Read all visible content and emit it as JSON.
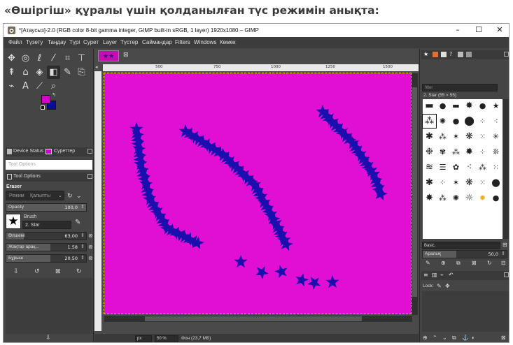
{
  "question": "«Өшіргіш» құралы үшін қолданылған түс режимін анықта:",
  "window": {
    "title": "*[Атаусыз]-2.0 (RGB color 8-bit gamma integer, GIMP built-in sRGB, 1 layer) 1920x1080 – GIMP",
    "minimize": "–",
    "maximize": "☐",
    "close": "✕"
  },
  "menu": [
    "Файл",
    "Түзету",
    "Таңдау",
    "Түрі",
    "Сурет",
    "Layer",
    "Түстер",
    "Саймандар",
    "Filters",
    "Windows",
    "Көмек"
  ],
  "colors": {
    "foreground": "#d400c8",
    "background": "#0a0aa0",
    "image_bg": "#e10ed4",
    "stars": "#1a0fae"
  },
  "left_dock": {
    "tab_device_status": "Device Status",
    "tab_colors": "Суреттер",
    "tool_options_search": "Tool Options",
    "tab_tool_options": "Tool Options",
    "tool_name": "Eraser",
    "mode_label": "Режим",
    "mode_value": "Қалыпты",
    "opacity_label": "Opacity",
    "opacity_value": "100,0",
    "brush_label": "Brush",
    "brush_value": "2. Star",
    "size_label": "Өлшемі",
    "size_value": "63,00",
    "aspect_label": "Жақтар арақ...",
    "aspect_value": "1,58",
    "angle_label": "Бұрыш",
    "angle_value": "20,50"
  },
  "canvas": {
    "ruler_ticks": [
      "500",
      "750",
      "1000",
      "1250",
      "1500"
    ],
    "unit": "px",
    "zoom": "50 %",
    "status": "Фон (23,7 МБ)"
  },
  "right_dock": {
    "filter_placeholder": "filter",
    "brush_title": "2. Star (55 × 55)",
    "preset": "Basic,",
    "spacing_label": "Аралық",
    "spacing_value": "50,0",
    "lock_label": "Lock:"
  }
}
